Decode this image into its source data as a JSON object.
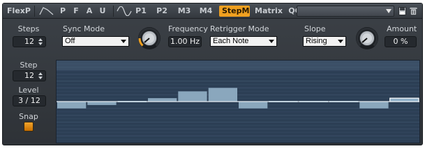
{
  "tabs": {
    "flexp": "FlexP",
    "p": "P",
    "f": "F",
    "a": "A",
    "u": "U",
    "p1": "P1",
    "p2": "P2",
    "m3": "M3",
    "m4": "M4",
    "stepm": "StepM",
    "matrix": "Matrix",
    "qc": "QC",
    "active": "StepM"
  },
  "preset": {
    "value": ""
  },
  "controls": {
    "steps": {
      "label": "Steps",
      "value": "12"
    },
    "sync_mode": {
      "label": "Sync Mode",
      "value": "Off"
    },
    "frequency": {
      "label": "Frequency",
      "value": "1.00 Hz"
    },
    "retrigger_mode": {
      "label": "Retrigger Mode",
      "value": "Each Note"
    },
    "slope": {
      "label": "Slope",
      "value": "Rising"
    },
    "amount": {
      "label": "Amount",
      "value": "0 %"
    }
  },
  "sidebar": {
    "step": {
      "label": "Step",
      "value": "12"
    },
    "level": {
      "label": "Level",
      "value": "3 / 12"
    },
    "snap": {
      "label": "Snap",
      "enabled": true
    }
  },
  "colors": {
    "accent": "#f0a020",
    "step_fill": "#8aa7bd",
    "grid_bg": "#2c3f55",
    "selected_step": "#8fb0c8"
  },
  "step_sequence": {
    "selected_step": 12,
    "levels": [
      -2,
      -1,
      0,
      1,
      3,
      4,
      -2,
      0,
      0,
      0,
      -2,
      1
    ]
  }
}
